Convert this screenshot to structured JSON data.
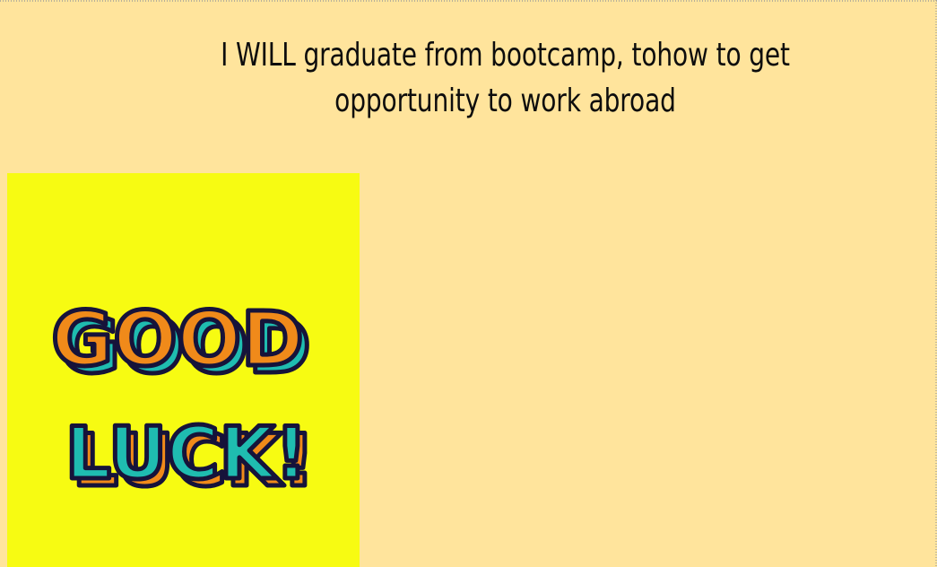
{
  "page": {
    "heading": "I WILL graduate from bootcamp, tohow to get opportunity to work abroad"
  },
  "image": {
    "word_top": "GOOD",
    "word_bottom": "LUCK!",
    "colors": {
      "background": "#ffe49c",
      "image_bg": "#f7fb12",
      "orange": "#f08a1a",
      "teal": "#1fbcb0",
      "outline": "#16133a"
    }
  }
}
